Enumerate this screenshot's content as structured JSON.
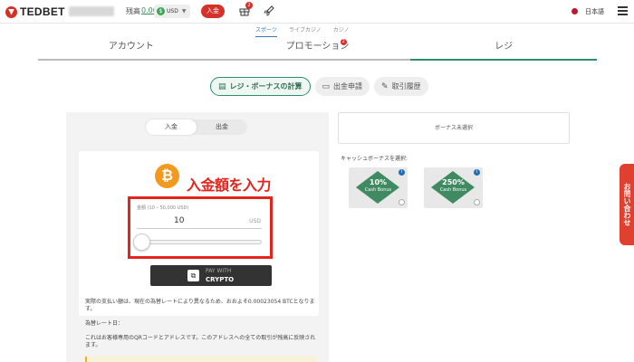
{
  "header": {
    "brand": "TEDBET",
    "balance_label": "残高",
    "balance_value": "0.00",
    "currency_icon": "$",
    "currency": "USD",
    "deposit_label": "入金",
    "gift_badge": "2",
    "language": "日本語"
  },
  "subnav": [
    "スポーツ",
    "ライブカジノ",
    "カジノ"
  ],
  "tabs": [
    {
      "label": "アカウント"
    },
    {
      "label": "プロモーション",
      "badge": "2"
    },
    {
      "label": "レジ"
    }
  ],
  "cashier_tabs": [
    "レジ・ボーナスの計算",
    "出金申請",
    "取引履歴"
  ],
  "deposit_form": {
    "toggle": [
      "入金",
      "出金"
    ],
    "coin_icon": "₿",
    "annotation": "入金額を入力",
    "field_label": "金額 (10 – 50,000 USD)",
    "amount": "10",
    "unit": "USD",
    "pay_line1": "PAY WITH",
    "pay_line2": "CRYPTO",
    "pay_icon": "⧉"
  },
  "notes": [
    "実際の支払い額は、現在の為替レートにより異なるため、おおよそ0.00023054 BTCとなります。",
    "為替レート日：",
    "これはお客様専用のQRコードとアドレスです。このアドレスへの全ての取引が残高に反映されます。"
  ],
  "bonus": {
    "status": "ボーナス未選択",
    "select_label": "キャッシュボーナスを選択:",
    "cards": [
      {
        "pct": "10%",
        "name": "Cash Bonus"
      },
      {
        "pct": "250%",
        "name": "Cash Bonus"
      }
    ]
  },
  "contact_label": "お問い合わせ",
  "colors": {
    "accent_green": "#2f8d6f",
    "brand_red": "#d6302a",
    "annotation_red": "#e3231c"
  }
}
